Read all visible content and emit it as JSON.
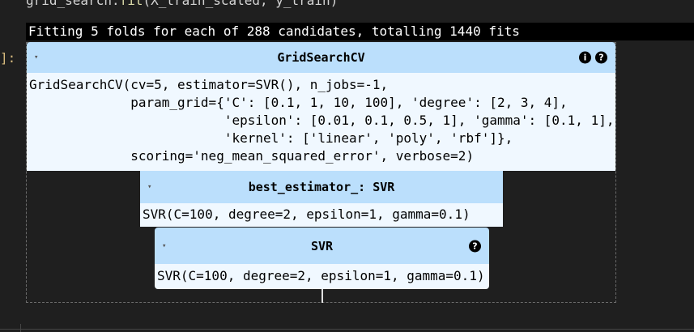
{
  "cell": {
    "code_obj": "grid_search.",
    "code_method": "fit",
    "code_args": "(X_train_scaled, y_train)",
    "prompt": "]:",
    "stdout": "Fitting 5 folds for each of 288 candidates, totalling 1440 fits"
  },
  "grid_search": {
    "title": "GridSearchCV",
    "info_icon": "i",
    "help_icon": "?",
    "repr_lines": [
      "GridSearchCV(cv=5, estimator=SVR(), n_jobs=-1,",
      "             param_grid={'C': [0.1, 1, 10, 100], 'degree': [2, 3, 4],",
      "                         'epsilon': [0.01, 0.1, 0.5, 1], 'gamma': [0.1, 1],",
      "                         'kernel': ['linear', 'poly', 'rbf']},",
      "             scoring='neg_mean_squared_error', verbose=2)"
    ]
  },
  "best_estimator": {
    "title": "best_estimator_: SVR",
    "repr": "SVR(C=100, degree=2, epsilon=1, gamma=0.1)"
  },
  "svr": {
    "title": "SVR",
    "help_icon": "?",
    "repr": "SVR(C=100, degree=2, epsilon=1, gamma=0.1)"
  },
  "icons": {
    "caret": "▾"
  }
}
